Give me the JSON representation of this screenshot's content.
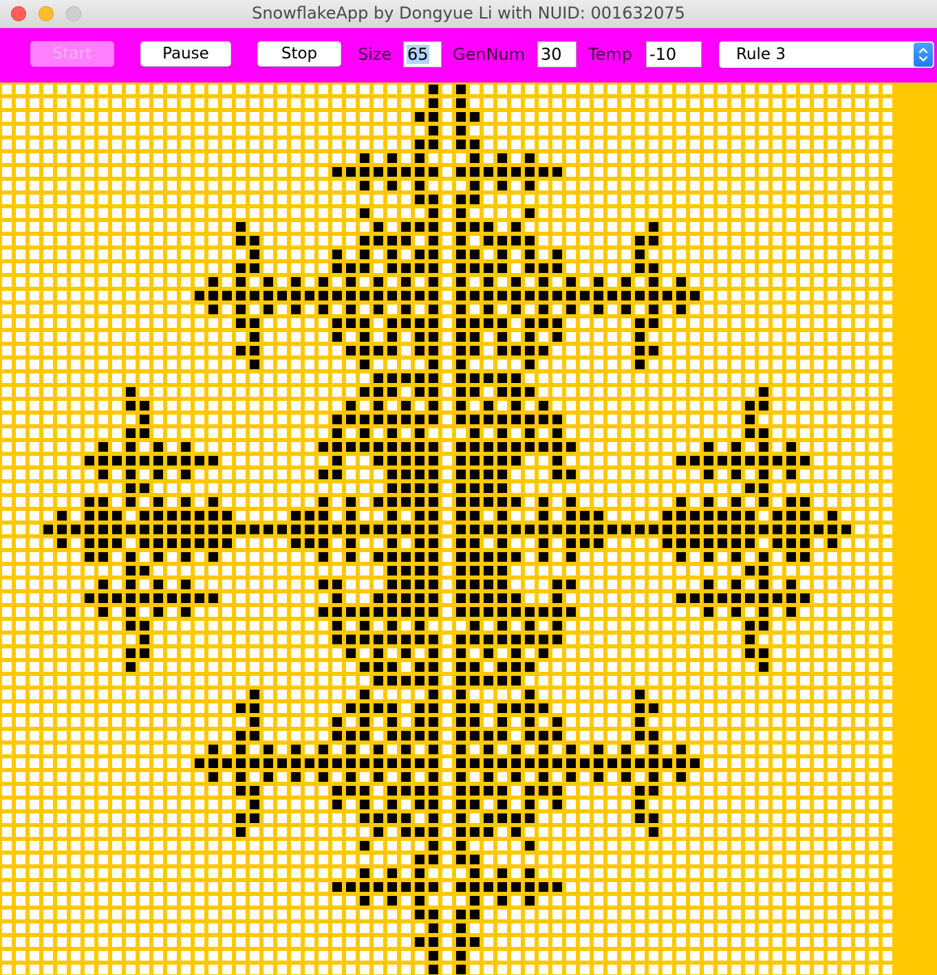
{
  "window": {
    "title": "SnowflakeApp by Dongyue Li with NUID: 001632075"
  },
  "toolbar": {
    "start_label": "Start",
    "pause_label": "Pause",
    "stop_label": "Stop",
    "size_label": "Size",
    "size_value": "65",
    "gennum_label": "GenNum",
    "gennum_value": "30",
    "temp_label": "Temp",
    "temp_value": "-10",
    "rule_selected": "Rule 3"
  },
  "colors": {
    "toolbar": "#ff00ff",
    "grid_lines": "#ffc800",
    "empty_cell": "#ffffff",
    "filled_cell": "#000000"
  },
  "grid": {
    "columns": 65,
    "rows": 65,
    "description_rule": "four-fold symmetric crystal centered at (32,32)",
    "quadrant": [
      "...............................X",
      "...............................X",
      "..............................XX",
      "...............................X",
      "..............................XX",
      "..........................X.X.X.",
      "........................XXXXXXXX",
      "..........................X.X.X.",
      "..............................XX",
      "..........................X....X",
      ".................X.........X.XXX",
      ".................XX.......XXXX.X",
      "..................X.....X.X.X.XX",
      ".................XX.....XXX.XXXX",
      "...............X.X.X.X.X.X.X.X.X",
      "..............XXXXXXXXXXXXXXXXXX",
      "...............X.X.X.X.X.X.X.X.X",
      ".................XX.....XXX.XXXX",
      "..................X.....X.X.X.XX",
      ".................XX......XXXX.XX",
      "..................X.......X....X",
      "...........................XXXXX",
      ".........X................XXX.XX",
      ".........XX..............X.X.X.X",
      "..........X.............XXXXXXXX",
      ".........XX.............X.X.X.X.",
      ".......X.X.X.X.........XXXXXXXXX",
      "......XXXXXXXXXX........X..XXXXX",
      ".......X.X.X.X.........XX...XXXX",
      ".........XX.................XXXX",
      "......XX.X.X.X.X.......X.X.XXXXX",
      "....X.XXX.XXXXXXX....XXX.X..X.XX",
      "...XXXXXXXXXXXXXXXXXXXXXXXXXXXXX"
    ]
  }
}
